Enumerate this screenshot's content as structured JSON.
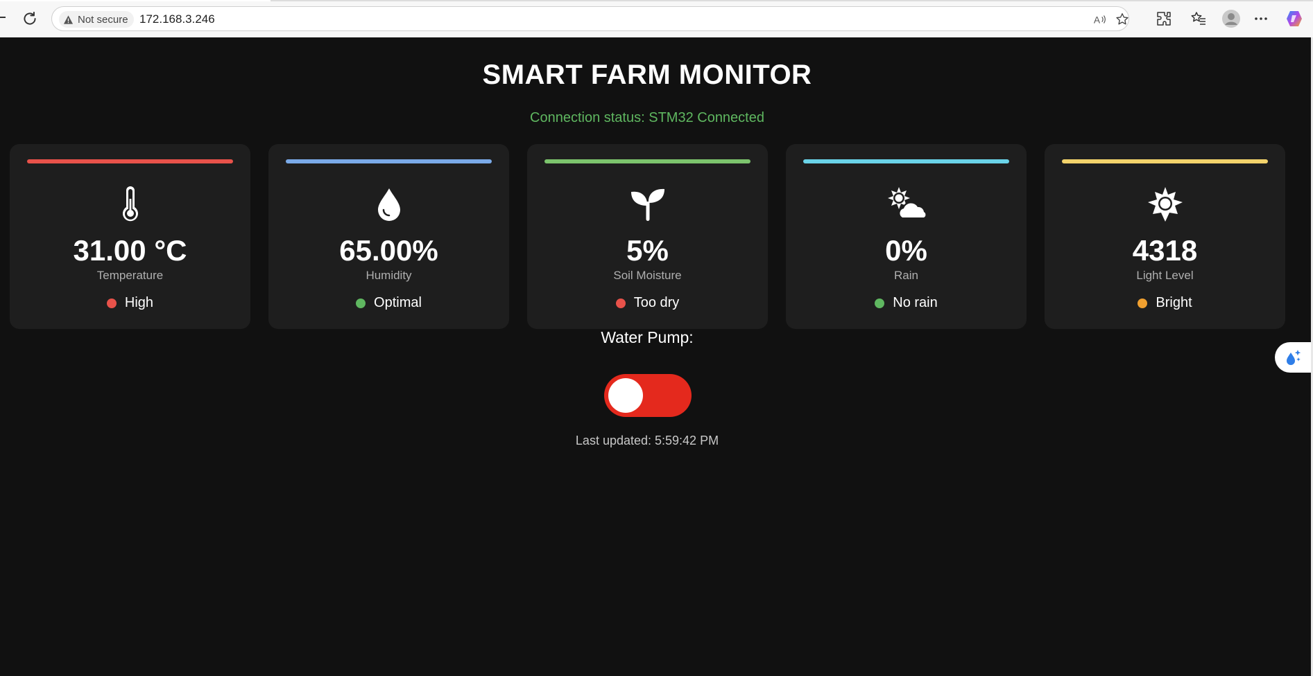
{
  "browser": {
    "security_label": "Not secure",
    "url": "172.168.3.246",
    "icons": [
      "reload-icon",
      "warning-icon",
      "read-aloud-icon",
      "favorite-star-icon",
      "extensions-icon",
      "favorites-icon",
      "profile-avatar-icon",
      "more-menu-icon",
      "copilot-icon"
    ]
  },
  "page": {
    "title": "SMART FARM MONITOR",
    "connection_status": "Connection status: STM32 Connected",
    "cards": [
      {
        "icon": "thermometer-icon",
        "accent": "#e8524a",
        "value": "31.00 °C",
        "label": "Temperature",
        "status": "High",
        "status_color": "#e8524a"
      },
      {
        "icon": "water-drop-icon",
        "accent": "#7aaae8",
        "value": "65.00%",
        "label": "Humidity",
        "status": "Optimal",
        "status_color": "#5fb760"
      },
      {
        "icon": "seedling-icon",
        "accent": "#7cc46d",
        "value": "5%",
        "label": "Soil Moisture",
        "status": "Too dry",
        "status_color": "#e8524a"
      },
      {
        "icon": "cloud-sun-icon",
        "accent": "#6ad3e8",
        "value": "0%",
        "label": "Rain",
        "status": "No rain",
        "status_color": "#5fb760"
      },
      {
        "icon": "sun-icon",
        "accent": "#f3d36b",
        "value": "4318",
        "label": "Light Level",
        "status": "Bright",
        "status_color": "#f0a030"
      }
    ],
    "pump": {
      "label": "Water Pump:",
      "state": "off",
      "track_color": "#e4291d"
    },
    "last_updated": "Last updated: 5:59:42 PM"
  }
}
